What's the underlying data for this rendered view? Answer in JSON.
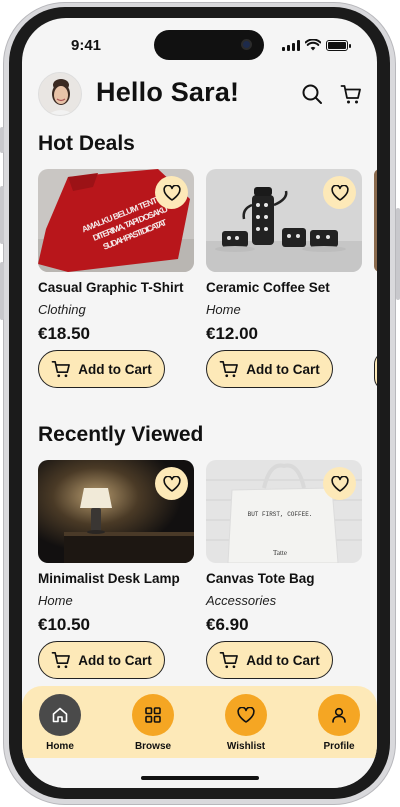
{
  "status_bar": {
    "time": "9:41"
  },
  "header": {
    "greeting": "Hello Sara!"
  },
  "sections": {
    "hot_deals": {
      "title": "Hot Deals",
      "items": [
        {
          "name": "Casual Graphic T-Shirt",
          "category": "Clothing",
          "price": "€18.50",
          "cta": "Add to Cart",
          "shirt_text": "AMALKU BELUM TENTU DITERIMA, TAPI DOSAKU SUDAH PASTI DICATAT"
        },
        {
          "name": "Ceramic Coffee Set",
          "category": "Home",
          "price": "€12.00",
          "cta": "Add to Cart"
        }
      ]
    },
    "recently_viewed": {
      "title": "Recently Viewed",
      "items": [
        {
          "name": "Minimalist Desk Lamp",
          "category": "Home",
          "price": "€10.50",
          "cta": "Add to Cart"
        },
        {
          "name": "Canvas Tote Bag",
          "category": "Accessories",
          "price": "€6.90",
          "cta": "Add to Cart",
          "bag_text": "BUT FIRST, COFFEE.",
          "bag_brand": "Tatte"
        }
      ]
    }
  },
  "bottom_nav": {
    "items": [
      {
        "label": "Home",
        "icon": "home-icon",
        "active": true
      },
      {
        "label": "Browse",
        "icon": "grid-icon",
        "active": false
      },
      {
        "label": "Wishlist",
        "icon": "heart-icon",
        "active": false
      },
      {
        "label": "Profile",
        "icon": "user-icon",
        "active": false
      }
    ]
  },
  "colors": {
    "accent": "#f5a623",
    "accent_light": "#fde9b8",
    "active_nav": "#4a4a4a",
    "text": "#111111",
    "background": "#f5f5f5"
  }
}
